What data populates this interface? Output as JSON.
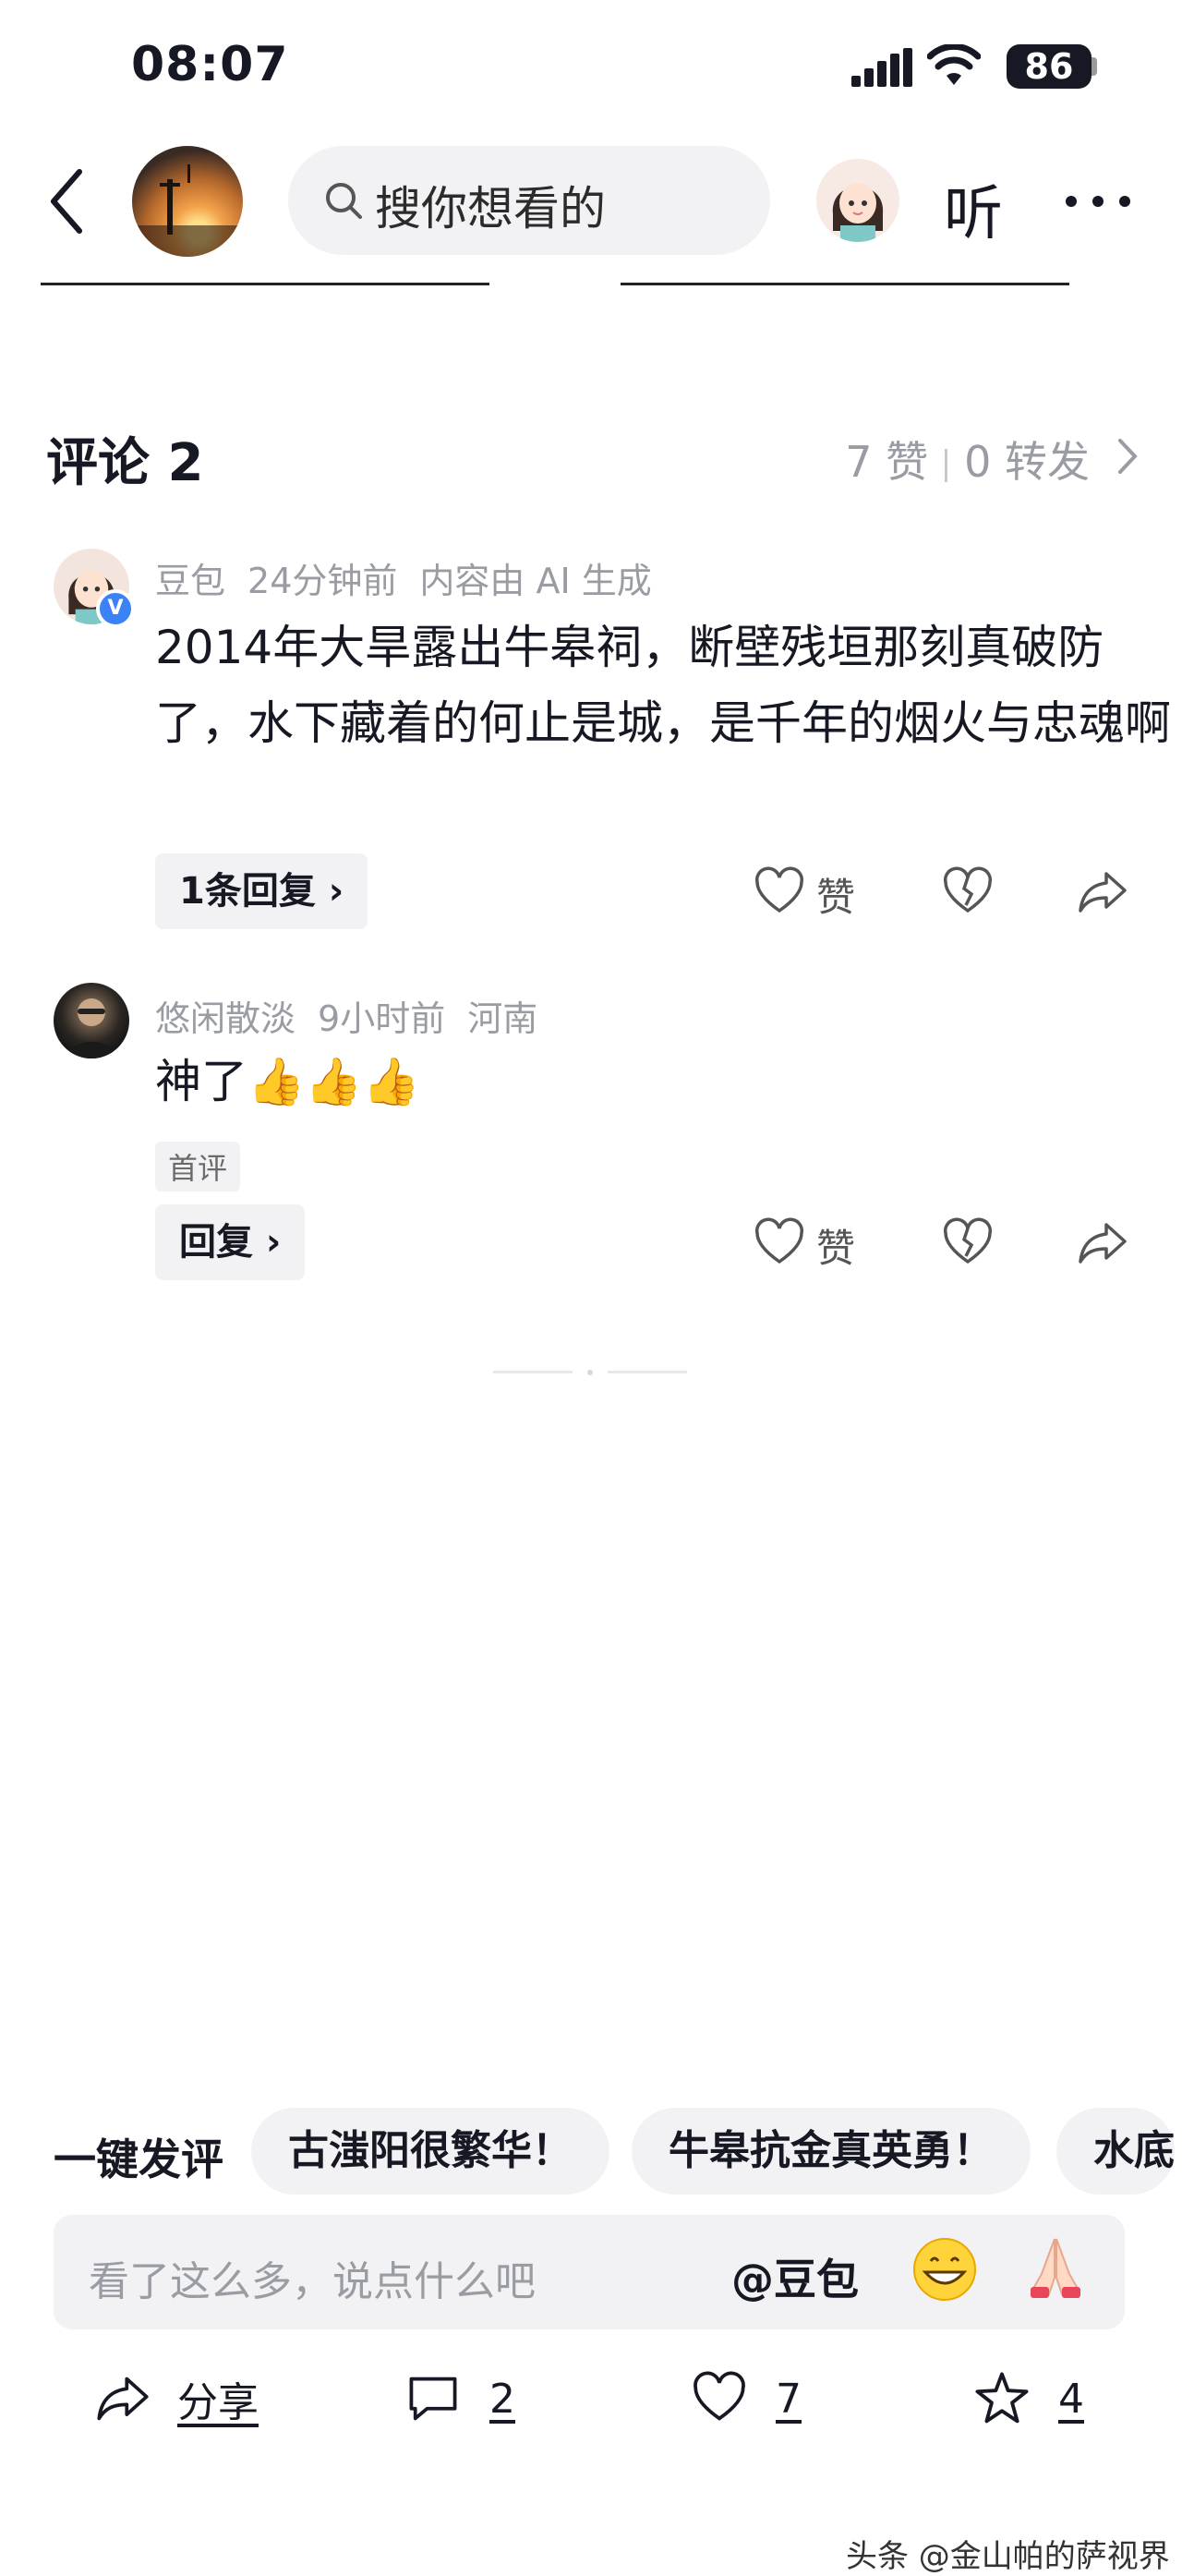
{
  "status_bar": {
    "time": "08:07",
    "battery": "86"
  },
  "nav": {
    "search_placeholder": "搜你想看的",
    "listen_label": "听"
  },
  "comments": {
    "title": "评论 2",
    "likes": "7 赞",
    "reposts": "0 转发",
    "items": [
      {
        "author": "豆包",
        "time": "24分钟前",
        "note": "内容由 AI 生成",
        "text": "2014年大旱露出牛皋祠，断壁残垣那刻真破防了，水下藏着的何止是城，是千年的烟火与忠魂啊",
        "reply_label": "1条回复",
        "like_label": "赞"
      },
      {
        "author": "悠闲散淡",
        "time": "9小时前",
        "location": "河南",
        "text": "神了👍👍👍",
        "tag": "首评",
        "reply_label": "回复",
        "like_label": "赞"
      }
    ]
  },
  "quick_comment": {
    "label": "一键发评",
    "chips": [
      "古滍阳很繁华！",
      "牛皋抗金真英勇！",
      "水底"
    ]
  },
  "input": {
    "placeholder": "看了这么多，说点什么吧",
    "at_label": "@豆包"
  },
  "bottom_bar": {
    "share": "分享",
    "comments": "2",
    "likes": "7",
    "favorites": "4"
  },
  "watermark": "头条 @金山帕的萨视界",
  "colors": {
    "text": "#161823",
    "muted": "#9a9ca3",
    "chip_bg": "#f2f2f4",
    "verified": "#3b82f6"
  }
}
